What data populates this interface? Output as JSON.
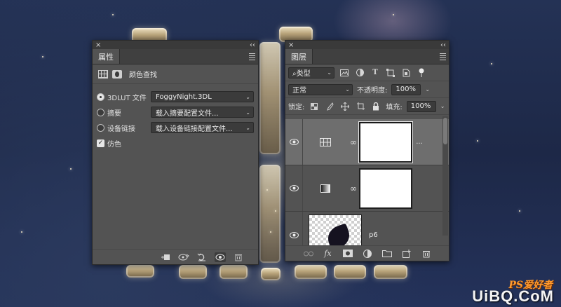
{
  "properties_panel": {
    "close_glyph": "×",
    "collapse_glyph": "‹‹",
    "tab_label": "属性",
    "header_label": "颜色查找",
    "options": [
      {
        "label": "3DLUT 文件",
        "value": "FoggyNight.3DL",
        "selected": true
      },
      {
        "label": "摘要",
        "value": "载入摘要配置文件...",
        "selected": false
      },
      {
        "label": "设备链接",
        "value": "载入设备链接配置文件...",
        "selected": false
      }
    ],
    "dither_label": "仿色",
    "dither_checked": true
  },
  "layers_panel": {
    "close_glyph": "×",
    "collapse_glyph": "‹‹",
    "tab_label": "图层",
    "filter_kind": "类型",
    "blend_mode": "正常",
    "opacity_label": "不透明度:",
    "opacity_value": "100%",
    "lock_label": "锁定:",
    "fill_label": "填充:",
    "fill_value": "100%",
    "layers": [
      {
        "type": "color-lookup-adjustment",
        "selected": true,
        "visible": true
      },
      {
        "type": "gradient-map-adjustment",
        "selected": false,
        "visible": true
      },
      {
        "type": "image",
        "name": "p6",
        "selected": false,
        "visible": true
      }
    ],
    "more_glyph": "...",
    "link_glyph": "∞"
  },
  "watermark": {
    "line1": "PS爱好者",
    "line2": "UiBQ.CoM"
  },
  "colors": {
    "panel": "#535353",
    "panel_dark": "#404040",
    "selected_layer": "#6e6e6e",
    "watermark_orange": "#ff9a2e"
  }
}
